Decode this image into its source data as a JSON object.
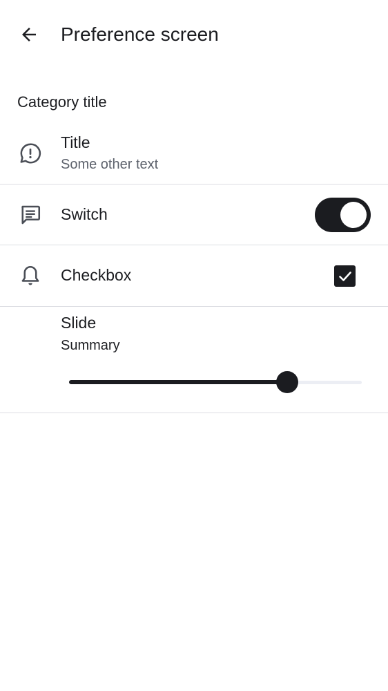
{
  "header": {
    "title": "Preference screen",
    "back_icon": "arrow-back-icon"
  },
  "category": {
    "title": "Category title"
  },
  "items": [
    {
      "type": "text",
      "icon": "alert-message-icon",
      "title": "Title",
      "summary": "Some other text"
    },
    {
      "type": "switch",
      "icon": "message-icon",
      "title": "Switch",
      "checked": true
    },
    {
      "type": "checkbox",
      "icon": "bell-icon",
      "title": "Checkbox",
      "checked": true
    },
    {
      "type": "slider",
      "title": "Slide",
      "summary": "Summary",
      "value": 0.745
    }
  ],
  "colors": {
    "primary": "#1b1c20",
    "summary_gray": "#5d626c",
    "track": "#eceef4",
    "divider": "#dcdde2",
    "icon_gray": "#4a4e56"
  }
}
